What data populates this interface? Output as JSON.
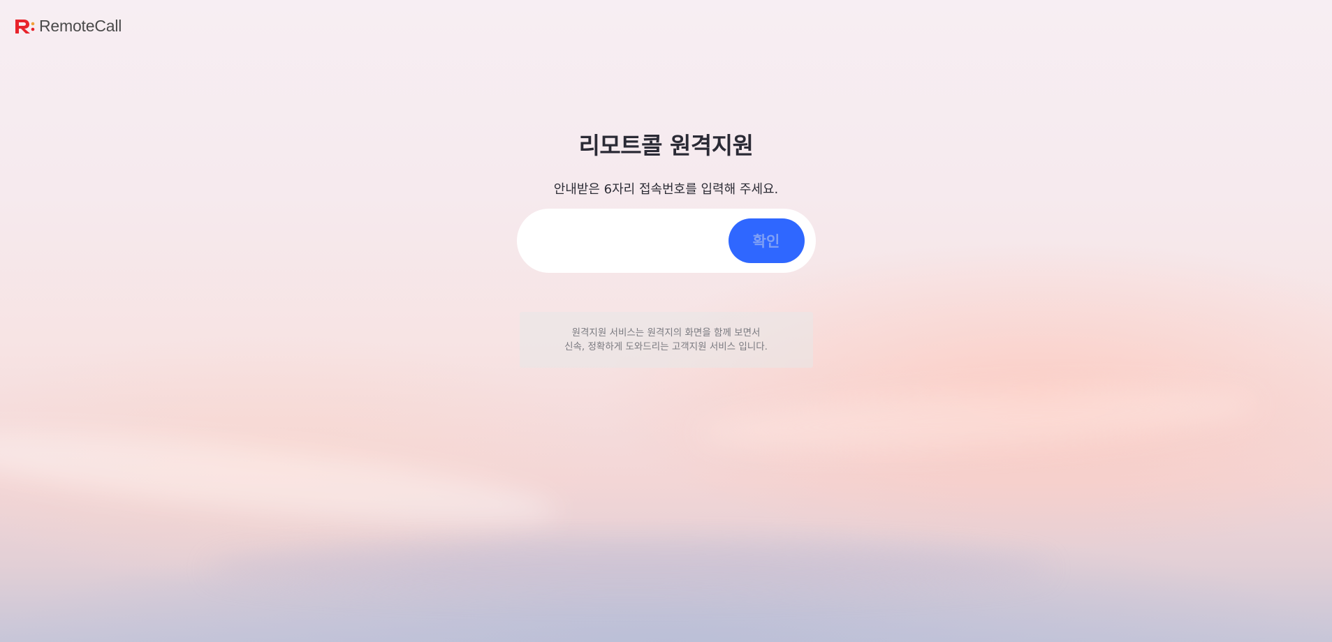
{
  "brand": {
    "logo_text": "RemoteCall",
    "logo_mark_colors": {
      "primary": "#e8232b",
      "accent": "#f0a23a"
    }
  },
  "main": {
    "title": "리모트콜 원격지원",
    "instruction": "안내받은 6자리 접속번호를 입력해 주세요.",
    "code_input": {
      "value": "",
      "placeholder": ""
    },
    "confirm_label": "확인",
    "info_lines": [
      "원격지원 서비스는 원격지의 화면을 함께 보면서",
      "신속, 정확하게 도와드리는 고객지원 서비스 입니다."
    ]
  },
  "colors": {
    "button": "#2f67ff",
    "button_text": "#7fa0f5",
    "title": "#2a2a35"
  },
  "icons": [
    "remotecall-logo-icon"
  ]
}
